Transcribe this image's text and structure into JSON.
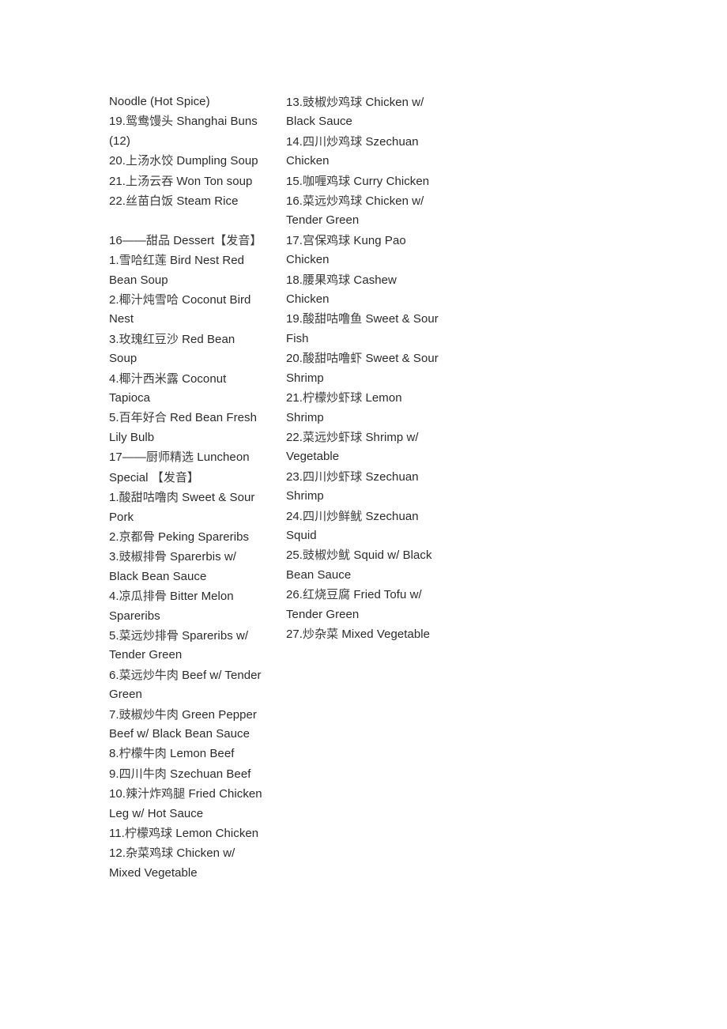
{
  "document": {
    "type": "restaurant-menu-text-page",
    "columns": [
      {
        "id": "left-column",
        "lines": [
          {
            "text": "Noodle (Hot Spice)"
          },
          {
            "num": "19.",
            "cn": "鸳鸯馒头",
            "en": "Shanghai Buns (12)"
          },
          {
            "num": "20.",
            "cn": "上汤水饺",
            "en": "Dumpling Soup"
          },
          {
            "num": "21.",
            "cn": "上汤云吞",
            "en": "Won Ton soup"
          },
          {
            "num": "22.",
            "cn": "丝苗白饭",
            "en": "Steam Rice"
          },
          {
            "blank": true
          },
          {
            "num": "16——",
            "cn": "甜品",
            "en": "Dessert",
            "cn_tail": "【发音】",
            "section": true
          },
          {
            "num": "1.",
            "cn": "雪哈红莲",
            "en": "Bird Nest Red Bean Soup"
          },
          {
            "num": "2.",
            "cn": "椰汁炖雪哈",
            "en": "Coconut Bird Nest"
          },
          {
            "num": "3.",
            "cn": "玫瑰红豆沙",
            "en": "Red Bean Soup"
          },
          {
            "num": "4.",
            "cn": "椰汁西米露",
            "en": "Coconut Tapioca"
          },
          {
            "num": "5.",
            "cn": "百年好合",
            "en": "Red Bean Fresh Lily Bulb"
          },
          {
            "num": "17——",
            "cn": "厨师精选",
            "en": "Luncheon Special ",
            "cn_tail": "【发音】",
            "section": true
          },
          {
            "num": "1.",
            "cn": "酸甜咕噜肉",
            "en": "Sweet & Sour Pork"
          },
          {
            "num": "2.",
            "cn": "京都骨",
            "en": "Peking Spareribs"
          },
          {
            "num": "3.",
            "cn": "豉椒排骨",
            "en": "Sparerbis w/ Black Bean Sauce"
          },
          {
            "num": "4.",
            "cn": "凉瓜排骨",
            "en": "Bitter Melon Spareribs"
          },
          {
            "num": "5.",
            "cn": "菜远炒排骨",
            "en": "Spareribs w/ Tender Green"
          },
          {
            "num": "6.",
            "cn": "菜远炒牛肉",
            "en": "Beef w/ Tender Green"
          },
          {
            "num": "7.",
            "cn": "豉椒炒牛肉",
            "en": "Green Pepper Beef w/ Black Bean Sauce"
          },
          {
            "num": "8.",
            "cn": "柠檬牛肉",
            "en": "Lemon Beef"
          },
          {
            "num": "9.",
            "cn": "四川牛肉",
            "en": "Szechuan Beef"
          },
          {
            "num": "10.",
            "cn": "辣汁炸鸡腿",
            "en": "Fried Chicken Leg w/ Hot Sauce"
          },
          {
            "num": "11.",
            "cn": "柠檬鸡球",
            "en": "Lemon Chicken"
          },
          {
            "num": "12.",
            "cn": "杂菜鸡球",
            "en": "Chicken w/ Mixed Vegetable"
          }
        ]
      },
      {
        "id": "right-column",
        "lines": [
          {
            "num": "13.",
            "cn": "豉椒炒鸡球",
            "en": "Chicken w/ Black Sauce"
          },
          {
            "num": "14.",
            "cn": "四川炒鸡球",
            "en": "Szechuan Chicken"
          },
          {
            "num": "15.",
            "cn": "咖喱鸡球",
            "en": "Curry Chicken"
          },
          {
            "num": "16.",
            "cn": "菜远炒鸡球",
            "en": "Chicken w/ Tender Green"
          },
          {
            "num": "17.",
            "cn": "宫保鸡球",
            "en": "Kung Pao Chicken"
          },
          {
            "num": "18.",
            "cn": "腰果鸡球",
            "en": "Cashew Chicken"
          },
          {
            "num": "19.",
            "cn": "酸甜咕噜鱼",
            "en": "Sweet & Sour Fish"
          },
          {
            "num": "20.",
            "cn": "酸甜咕噜虾",
            "en": "Sweet & Sour Shrimp"
          },
          {
            "num": "21.",
            "cn": "柠檬炒虾球",
            "en": "Lemon Shrimp"
          },
          {
            "num": "22.",
            "cn": "菜远炒虾球",
            "en": "Shrimp w/ Vegetable"
          },
          {
            "num": "23.",
            "cn": "四川炒虾球",
            "en": "Szechuan Shrimp"
          },
          {
            "num": "24.",
            "cn": "四川炒鲜鱿",
            "en": "Szechuan Squid"
          },
          {
            "num": "25.",
            "cn": "豉椒炒鱿",
            "en": "Squid w/ Black Bean Sauce"
          },
          {
            "num": "26.",
            "cn": "红烧豆腐",
            "en": "Fried Tofu w/ Tender Green"
          },
          {
            "num": "27.",
            "cn": "炒杂菜",
            "en": "Mixed Vegetable"
          }
        ]
      }
    ]
  }
}
